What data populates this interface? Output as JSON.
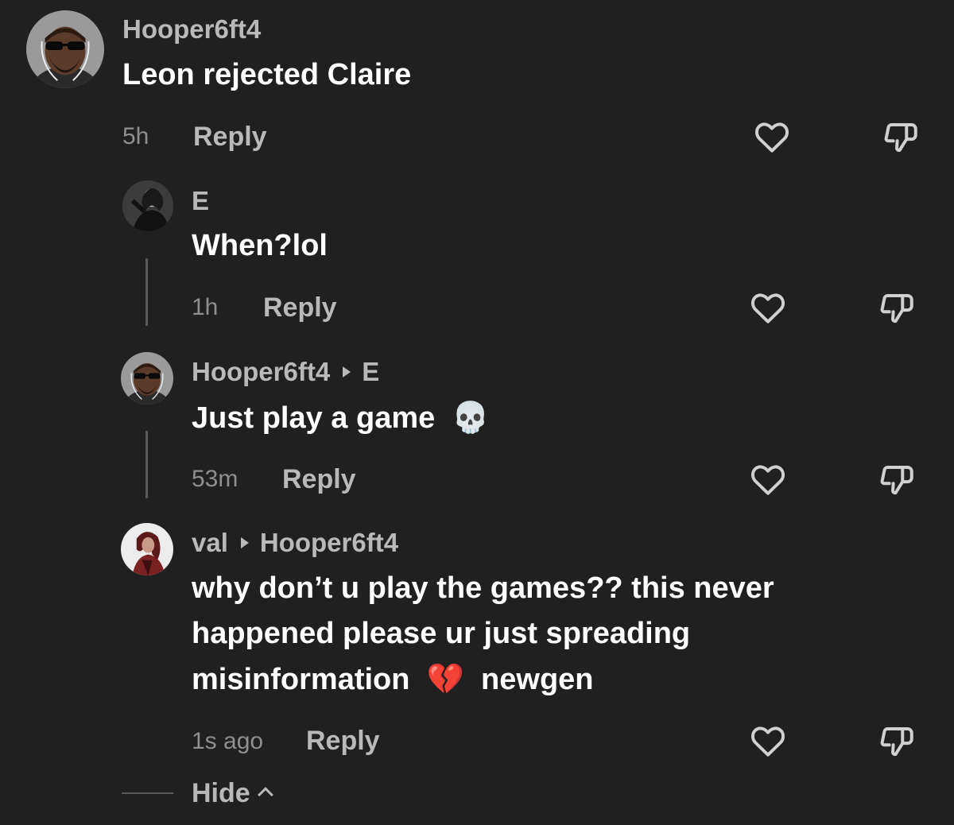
{
  "comments": [
    {
      "username": "Hooper6ft4",
      "text": "Leon rejected Claire",
      "time": "5h",
      "reply_label": "Reply"
    },
    {
      "username": "E",
      "text": "When?lol",
      "time": "1h",
      "reply_label": "Reply"
    },
    {
      "username": "Hooper6ft4",
      "reply_to": "E",
      "text": "Just play a game",
      "emoji": "💀",
      "time": "53m",
      "reply_label": "Reply"
    },
    {
      "username": "val",
      "reply_to": "Hooper6ft4",
      "text_line1": "why don’t u play the games?? this never",
      "text_line2": "happened please ur just spreading",
      "text_line3_a": "misinformation",
      "emoji": "💔",
      "text_line3_b": "newgen",
      "time": "1s ago",
      "reply_label": "Reply"
    }
  ],
  "hide_label": "Hide",
  "icons": {
    "like": "heart-icon",
    "dislike": "thumbs-down-icon"
  },
  "colors": {
    "background": "#202020",
    "text": "#ffffff",
    "username": "#b9b9b9",
    "meta": "#8f8f8f"
  }
}
